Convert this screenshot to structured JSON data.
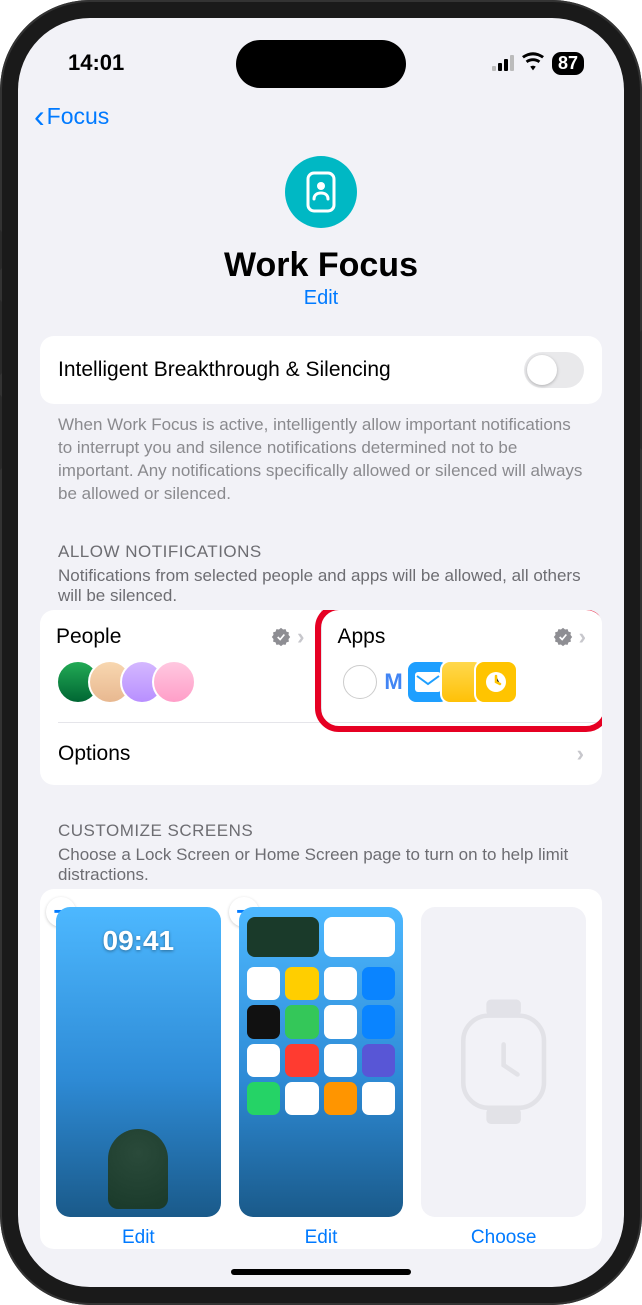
{
  "status": {
    "time": "14:01",
    "battery": "87"
  },
  "nav": {
    "back_label": "Focus"
  },
  "hero": {
    "title": "Work Focus",
    "edit": "Edit"
  },
  "intelligent": {
    "label": "Intelligent Breakthrough & Silencing",
    "footer": "When Work Focus is active, intelligently allow important notifications to interrupt you and silence notifications determined not to be important. Any notifications specifically allowed or silenced will always be allowed or silenced."
  },
  "allow": {
    "header": "ALLOW NOTIFICATIONS",
    "sub": "Notifications from selected people and apps will be allowed, all others will be silenced.",
    "people_label": "People",
    "apps_label": "Apps",
    "options_label": "Options"
  },
  "customize": {
    "header": "CUSTOMIZE SCREENS",
    "sub": "Choose a Lock Screen or Home Screen page to turn on to help limit distractions.",
    "edit_label": "Edit",
    "choose_label": "Choose",
    "lock_time": "09:41"
  }
}
